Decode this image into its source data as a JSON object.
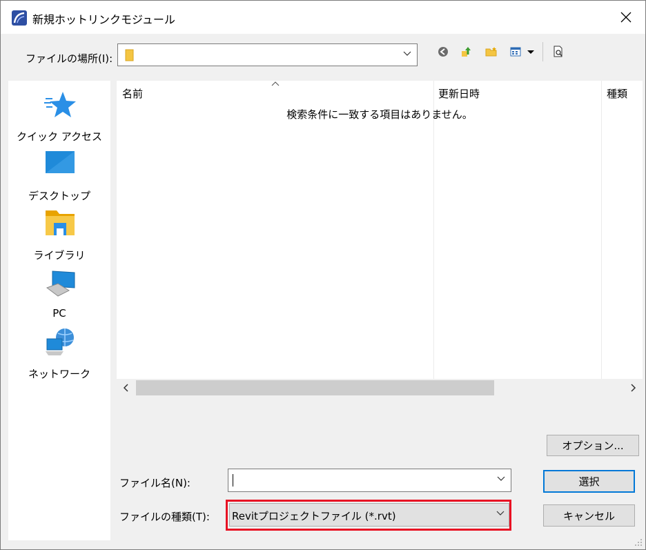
{
  "window": {
    "title": "新規ホットリンクモジュール"
  },
  "location": {
    "label": "ファイルの場所(I):",
    "value": ""
  },
  "toolbar": {
    "back_icon": "back-arrow-icon",
    "up_icon": "up-folder-icon",
    "new_folder_icon": "new-folder-icon",
    "view_icon": "view-menu-icon",
    "preview_icon": "preview-icon"
  },
  "places": [
    {
      "label": "クイック アクセス",
      "icon": "quick-access-star-icon"
    },
    {
      "label": "デスクトップ",
      "icon": "desktop-icon"
    },
    {
      "label": "ライブラリ",
      "icon": "library-folder-icon"
    },
    {
      "label": "PC",
      "icon": "pc-icon"
    },
    {
      "label": "ネットワーク",
      "icon": "network-icon"
    }
  ],
  "filelist": {
    "columns": [
      "名前",
      "更新日時",
      "種類"
    ],
    "empty_message": "検索条件に一致する項目はありません。"
  },
  "buttons": {
    "options": "オプション...",
    "select": "選択",
    "cancel": "キャンセル"
  },
  "filename": {
    "label": "ファイル名(N):",
    "value": ""
  },
  "filetype": {
    "label": "ファイルの種類(T):",
    "value": "Revitプロジェクトファイル (*.rvt)"
  },
  "colors": {
    "highlight_box": "#e81123",
    "default_button_border": "#0078d7"
  }
}
